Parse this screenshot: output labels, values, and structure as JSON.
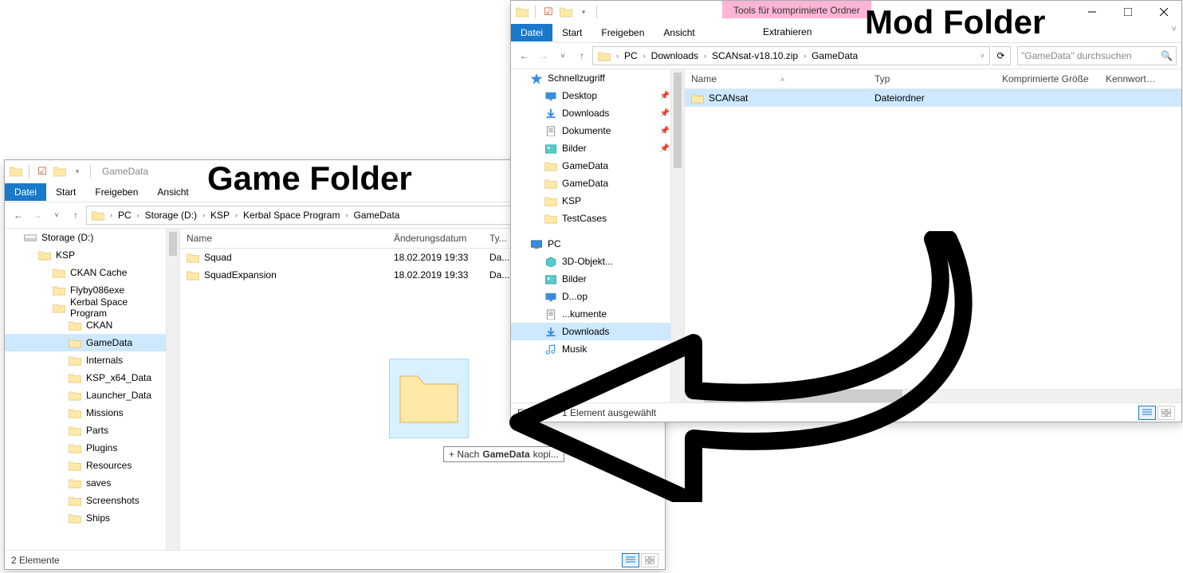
{
  "annotations": {
    "game": "Game Folder",
    "mod": "Mod Folder"
  },
  "win1": {
    "title": "GameData",
    "ribbon": {
      "file": "Datei",
      "start": "Start",
      "share": "Freigeben",
      "view": "Ansicht"
    },
    "crumbs": [
      "PC",
      "Storage (D:)",
      "KSP",
      "Kerbal Space Program",
      "GameData"
    ],
    "search_placeholder": "\"...",
    "cols": {
      "name": "Name",
      "date": "Änderungsdatum",
      "type": "Ty..."
    },
    "rows": [
      {
        "name": "Squad",
        "date": "18.02.2019 19:33",
        "type": "Da..."
      },
      {
        "name": "SquadExpansion",
        "date": "18.02.2019 19:33",
        "type": "Da..."
      }
    ],
    "nav": [
      {
        "label": "Storage (D:)",
        "indent": 1,
        "icon": "drive"
      },
      {
        "label": "KSP",
        "indent": 2,
        "icon": "folder"
      },
      {
        "label": "CKAN Cache",
        "indent": 3,
        "icon": "folder"
      },
      {
        "label": "Flyby086exe",
        "indent": 3,
        "icon": "folder"
      },
      {
        "label": "Kerbal Space Program",
        "indent": 3,
        "icon": "folder"
      },
      {
        "label": "CKAN",
        "indent": 4,
        "icon": "folder"
      },
      {
        "label": "GameData",
        "indent": 4,
        "icon": "folder",
        "selected": true
      },
      {
        "label": "Internals",
        "indent": 4,
        "icon": "folder"
      },
      {
        "label": "KSP_x64_Data",
        "indent": 4,
        "icon": "folder"
      },
      {
        "label": "Launcher_Data",
        "indent": 4,
        "icon": "folder"
      },
      {
        "label": "Missions",
        "indent": 4,
        "icon": "folder"
      },
      {
        "label": "Parts",
        "indent": 4,
        "icon": "folder"
      },
      {
        "label": "Plugins",
        "indent": 4,
        "icon": "folder"
      },
      {
        "label": "Resources",
        "indent": 4,
        "icon": "folder"
      },
      {
        "label": "saves",
        "indent": 4,
        "icon": "folder"
      },
      {
        "label": "Screenshots",
        "indent": 4,
        "icon": "folder"
      },
      {
        "label": "Ships",
        "indent": 4,
        "icon": "folder"
      }
    ],
    "status": "2 Elemente",
    "drag_tooltip_prefix": "+ Nach ",
    "drag_tooltip_bold": "GameData",
    "drag_tooltip_suffix": " kopi..."
  },
  "win2": {
    "context_tab": "Tools für komprimierte Ordner",
    "context_label": "Extrahieren",
    "ribbon": {
      "file": "Datei",
      "start": "Start",
      "share": "Freigeben",
      "view": "Ansicht"
    },
    "crumbs": [
      "PC",
      "Downloads",
      "SCANsat-v18.10.zip",
      "GameData"
    ],
    "search_placeholder": "\"GameData\" durchsuchen",
    "cols": {
      "name": "Name",
      "type": "Typ",
      "size": "Komprimierte Größe",
      "pw": "Kennwortg..."
    },
    "rows": [
      {
        "name": "SCANsat",
        "type": "Dateiordner",
        "selected": true
      }
    ],
    "nav": [
      {
        "label": "Schnellzugriff",
        "indent": 1,
        "icon": "star"
      },
      {
        "label": "Desktop",
        "indent": 2,
        "icon": "desktop",
        "pinned": true
      },
      {
        "label": "Downloads",
        "indent": 2,
        "icon": "download",
        "pinned": true
      },
      {
        "label": "Dokumente",
        "indent": 2,
        "icon": "doc",
        "pinned": true
      },
      {
        "label": "Bilder",
        "indent": 2,
        "icon": "pic",
        "pinned": true
      },
      {
        "label": "GameData",
        "indent": 2,
        "icon": "folder"
      },
      {
        "label": "GameData",
        "indent": 2,
        "icon": "folder"
      },
      {
        "label": "KSP",
        "indent": 2,
        "icon": "folder"
      },
      {
        "label": "TestCases",
        "indent": 2,
        "icon": "folder"
      },
      {
        "label": "PC",
        "indent": 1,
        "icon": "pc",
        "gap": true
      },
      {
        "label": "3D-Objekt...",
        "indent": 2,
        "icon": "3d"
      },
      {
        "label": "Bilder",
        "indent": 2,
        "icon": "pic"
      },
      {
        "label": "D...op",
        "indent": 2,
        "icon": "desktop"
      },
      {
        "label": "...kumente",
        "indent": 2,
        "icon": "doc"
      },
      {
        "label": "Downloads",
        "indent": 2,
        "icon": "download",
        "selected": true
      },
      {
        "label": "Musik",
        "indent": 2,
        "icon": "music"
      }
    ],
    "status1": "Element",
    "status2": "1 Element ausgewählt"
  }
}
